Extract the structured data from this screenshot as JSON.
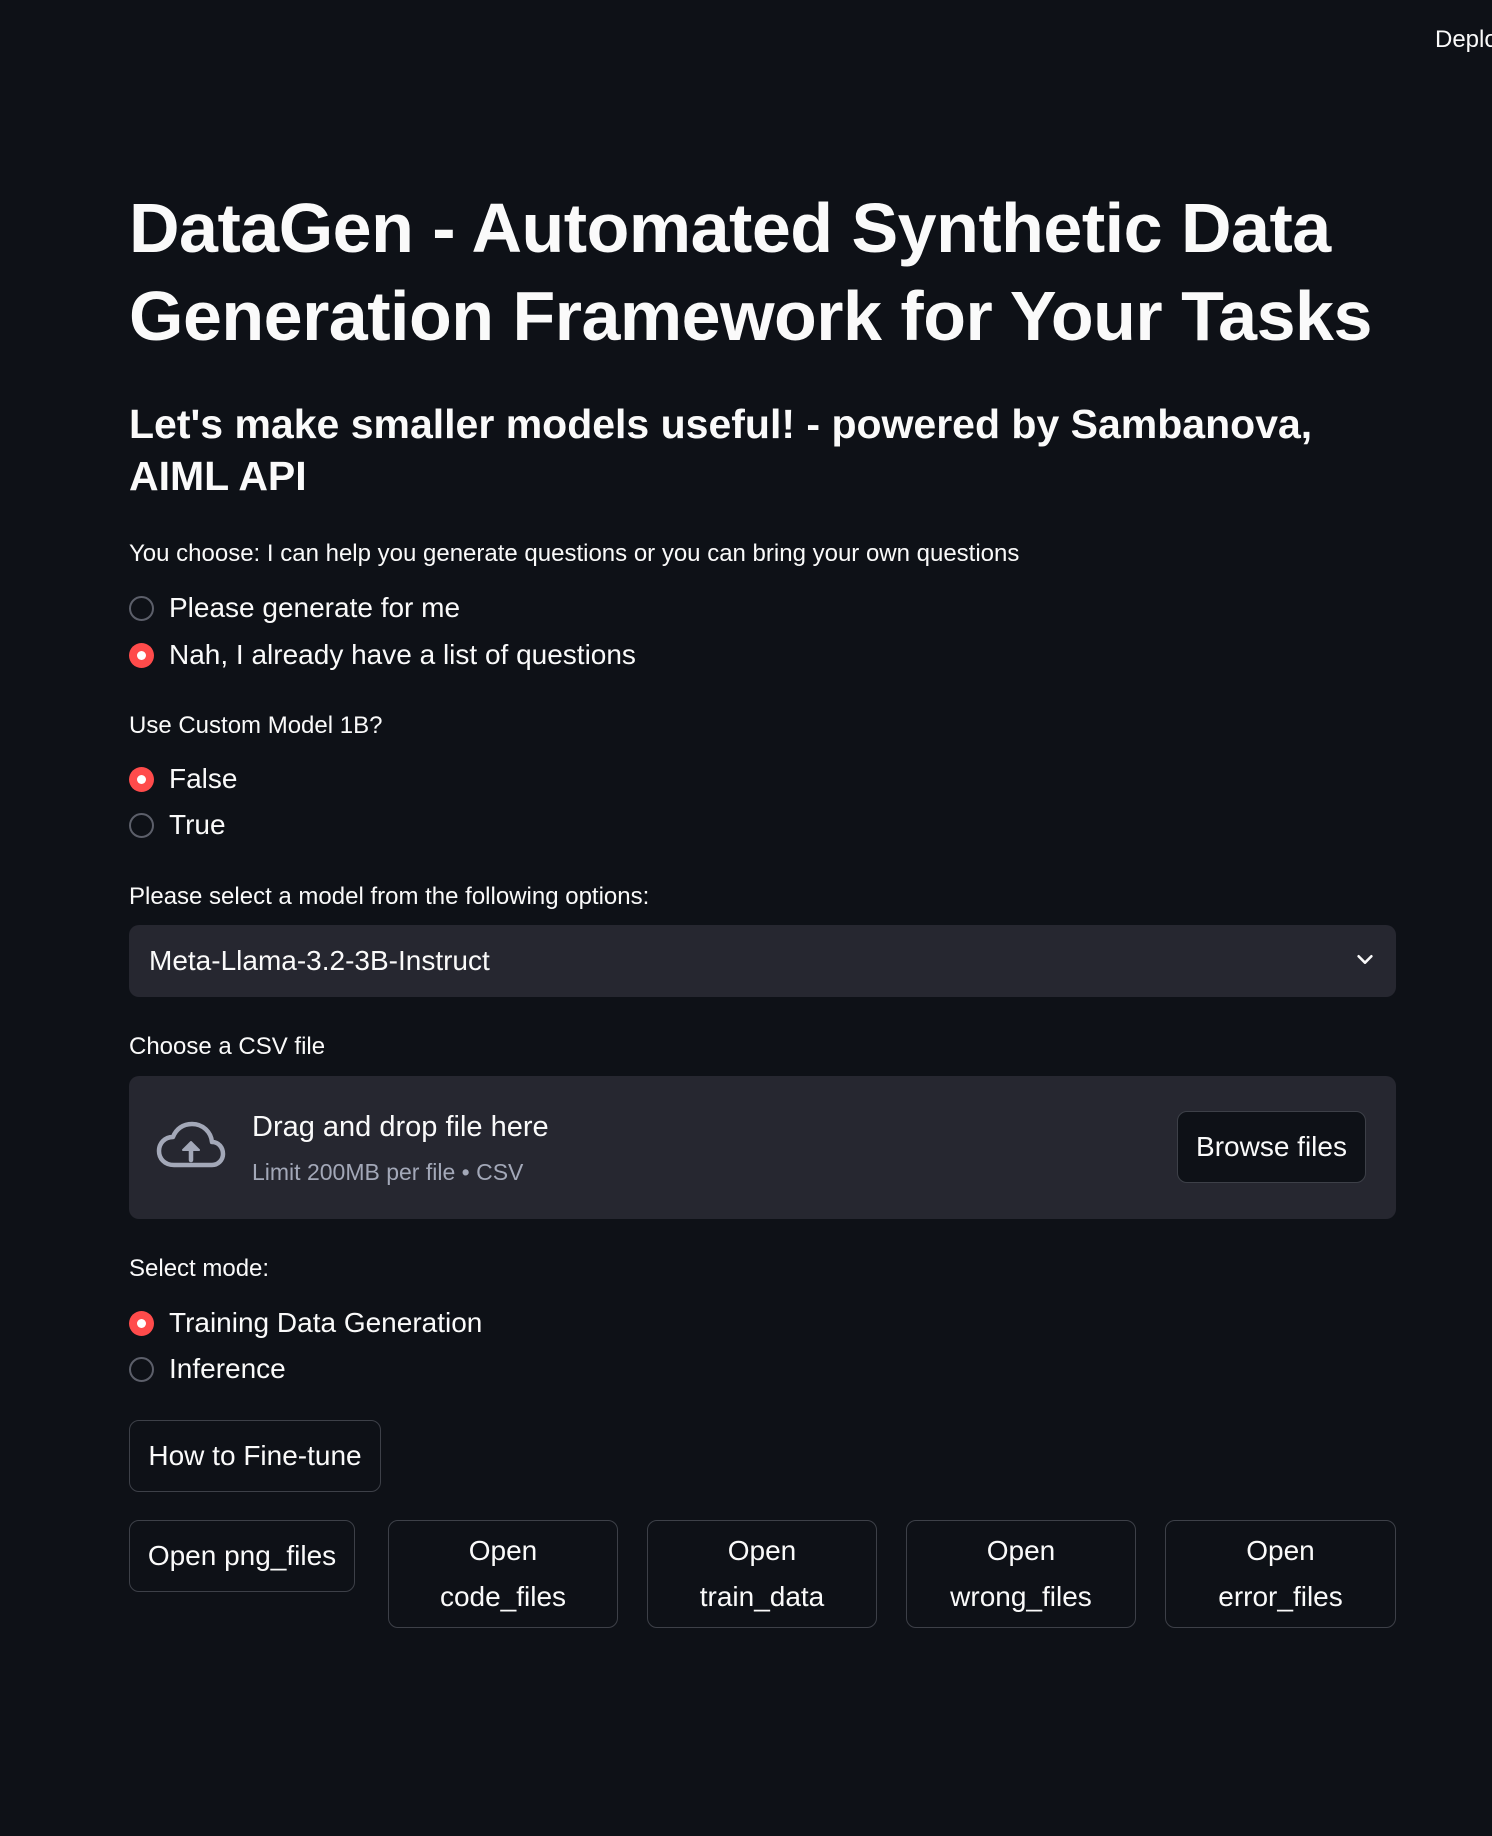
{
  "header": {
    "deploy_label": "Deplo"
  },
  "page": {
    "title": "DataGen - Automated Synthetic Data Generation Framework for Your Tasks",
    "subtitle": "Let's make smaller models useful! - powered by Sambanova, AIML API"
  },
  "question_source": {
    "label": "You choose: I can help you generate questions or you can bring your own questions",
    "options": [
      {
        "label": "Please generate for me",
        "selected": false
      },
      {
        "label": "Nah, I already have a list of questions",
        "selected": true
      }
    ]
  },
  "custom_model": {
    "label": "Use Custom Model 1B?",
    "options": [
      {
        "label": "False",
        "selected": true
      },
      {
        "label": "True",
        "selected": false
      }
    ]
  },
  "model_select": {
    "label": "Please select a model from the following options:",
    "value": "Meta-Llama-3.2-3B-Instruct",
    "icon": "chevron-down-icon"
  },
  "file_upload": {
    "label": "Choose a CSV file",
    "drop_text": "Drag and drop file here",
    "limit_text": "Limit 200MB per file • CSV",
    "browse_label": "Browse files",
    "icon": "cloud-upload-icon"
  },
  "mode": {
    "label": "Select mode:",
    "options": [
      {
        "label": "Training Data Generation",
        "selected": true
      },
      {
        "label": "Inference",
        "selected": false
      }
    ]
  },
  "buttons": {
    "fine_tune": "How to Fine-tune",
    "open_png": "Open png_files",
    "open_code": [
      "Open",
      "code_files"
    ],
    "open_train": [
      "Open",
      "train_data"
    ],
    "open_wrong": [
      "Open",
      "wrong_files"
    ],
    "open_error": [
      "Open",
      "error_files"
    ]
  },
  "colors": {
    "background": "#0e1117",
    "accent": "#ff4b4b",
    "widget_bg": "#262730",
    "text": "#fafafa",
    "muted_text": "#a3a8b8"
  }
}
